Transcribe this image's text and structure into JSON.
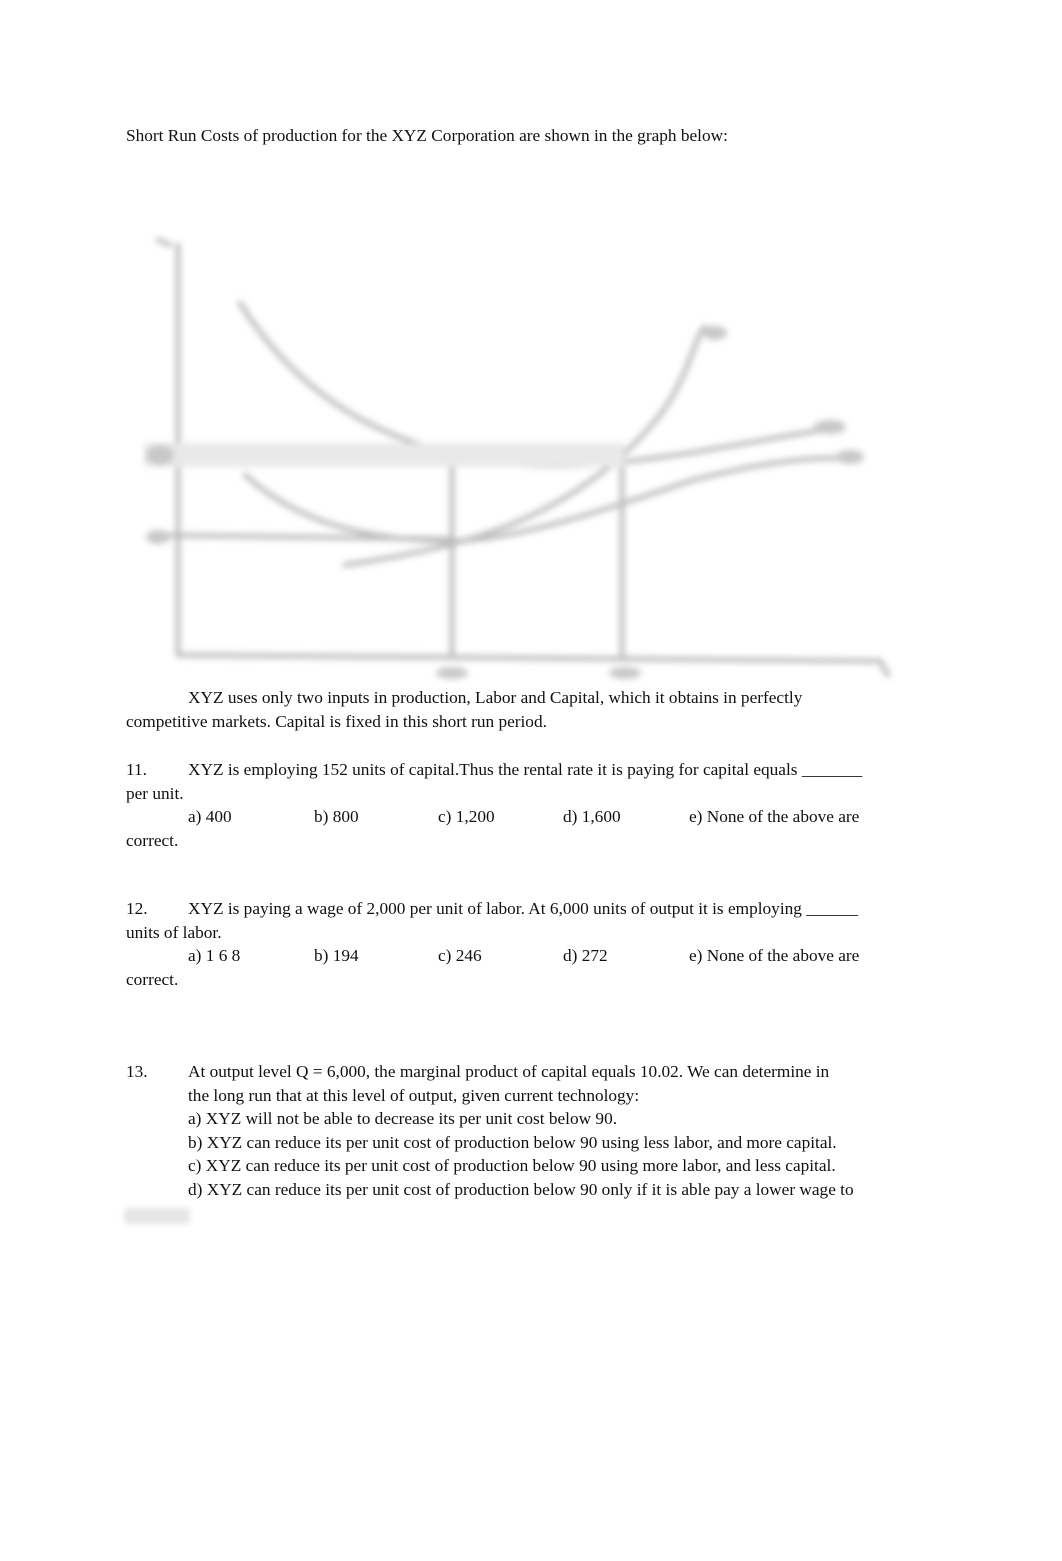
{
  "intro": "Short Run Costs of production for the XYZ Corporation are shown in the graph below:",
  "graph": {
    "description": "Blurred short-run cost curves (ATC, AVC, MC shapes) with two vertical reference lines; labels unreadable",
    "curve_color": "#bdbdbd"
  },
  "context": {
    "line1": "XYZ uses only two inputs in production, Labor and Capital, which it obtains in perfectly",
    "line2": "competitive markets.    Capital is fixed in this short run period."
  },
  "questions": [
    {
      "number": "11.",
      "text_line1": "XYZ is employing 152 units of capital.Thus the rental rate it is paying for capital equals _______",
      "text_line2": "per unit.",
      "options": [
        "a)  400",
        "b) 800",
        "c) 1,200",
        "d) 1,600",
        "e)  None of the above are"
      ],
      "option_wrap": "correct."
    },
    {
      "number": "12.",
      "text_line1": "XYZ is paying a wage of 2,000 per unit of labor. At 6,000 units of output it is employing ______",
      "text_line2": "units of labor.",
      "options": [
        "a)  1 6 8",
        "b) 194",
        "c) 246",
        "d) 272",
        "e)  None of the above are"
      ],
      "option_wrap": "correct."
    },
    {
      "number": "13.",
      "text_line1": "At output level Q = 6,000, the marginal product of capital equals 10.02.    We can determine in",
      "text_line2": "the long run that at this level of output, given current technology:",
      "options": [
        "a)  XYZ will not be able to decrease its per unit cost below 90.",
        "b)  XYZ can reduce its per unit cost of production below 90 using less labor, and more capital.",
        "c)  XYZ can reduce its per unit cost of production below 90 using more labor, and less capital.",
        "d)  XYZ can reduce its per unit cost of production below 90 only if it is able pay a lower wage to"
      ]
    }
  ]
}
